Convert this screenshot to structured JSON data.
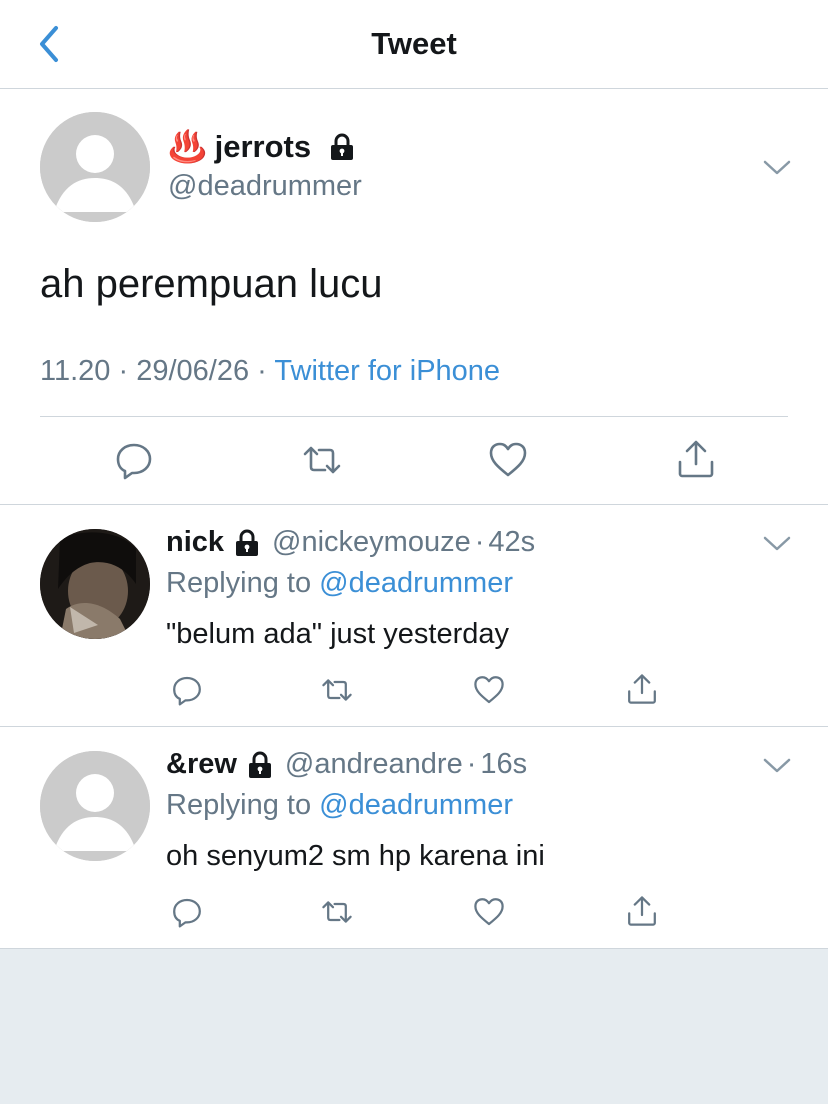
{
  "nav": {
    "title": "Tweet",
    "back_icon": "chevron-left-icon"
  },
  "tweet": {
    "emoji": "♨️",
    "name": "jerrots",
    "handle": "@deadrummer",
    "text": "ah perempuan lucu",
    "time": "11.20",
    "date": "29/06/26",
    "source": "Twitter for iPhone",
    "dot": "·"
  },
  "replies": [
    {
      "name": "nick",
      "handle": "@nickeymouze",
      "age": "42s",
      "replying_label": "Replying to",
      "replying_to": "@deadrummer",
      "text": "\"belum ada\" just yesterday"
    },
    {
      "name": "&rew",
      "handle": "@andreandre",
      "age": "16s",
      "replying_label": "Replying to",
      "replying_to": "@deadrummer",
      "text": "oh senyum2 sm hp karena ini"
    }
  ],
  "colors": {
    "link": "#3b8fd6",
    "secondary": "#657786",
    "divider": "#cfd6dc",
    "background": "#e6ecf0"
  },
  "icons": [
    "reply-icon",
    "retweet-icon",
    "like-icon",
    "share-icon",
    "lock-icon",
    "chevron-down-icon"
  ]
}
